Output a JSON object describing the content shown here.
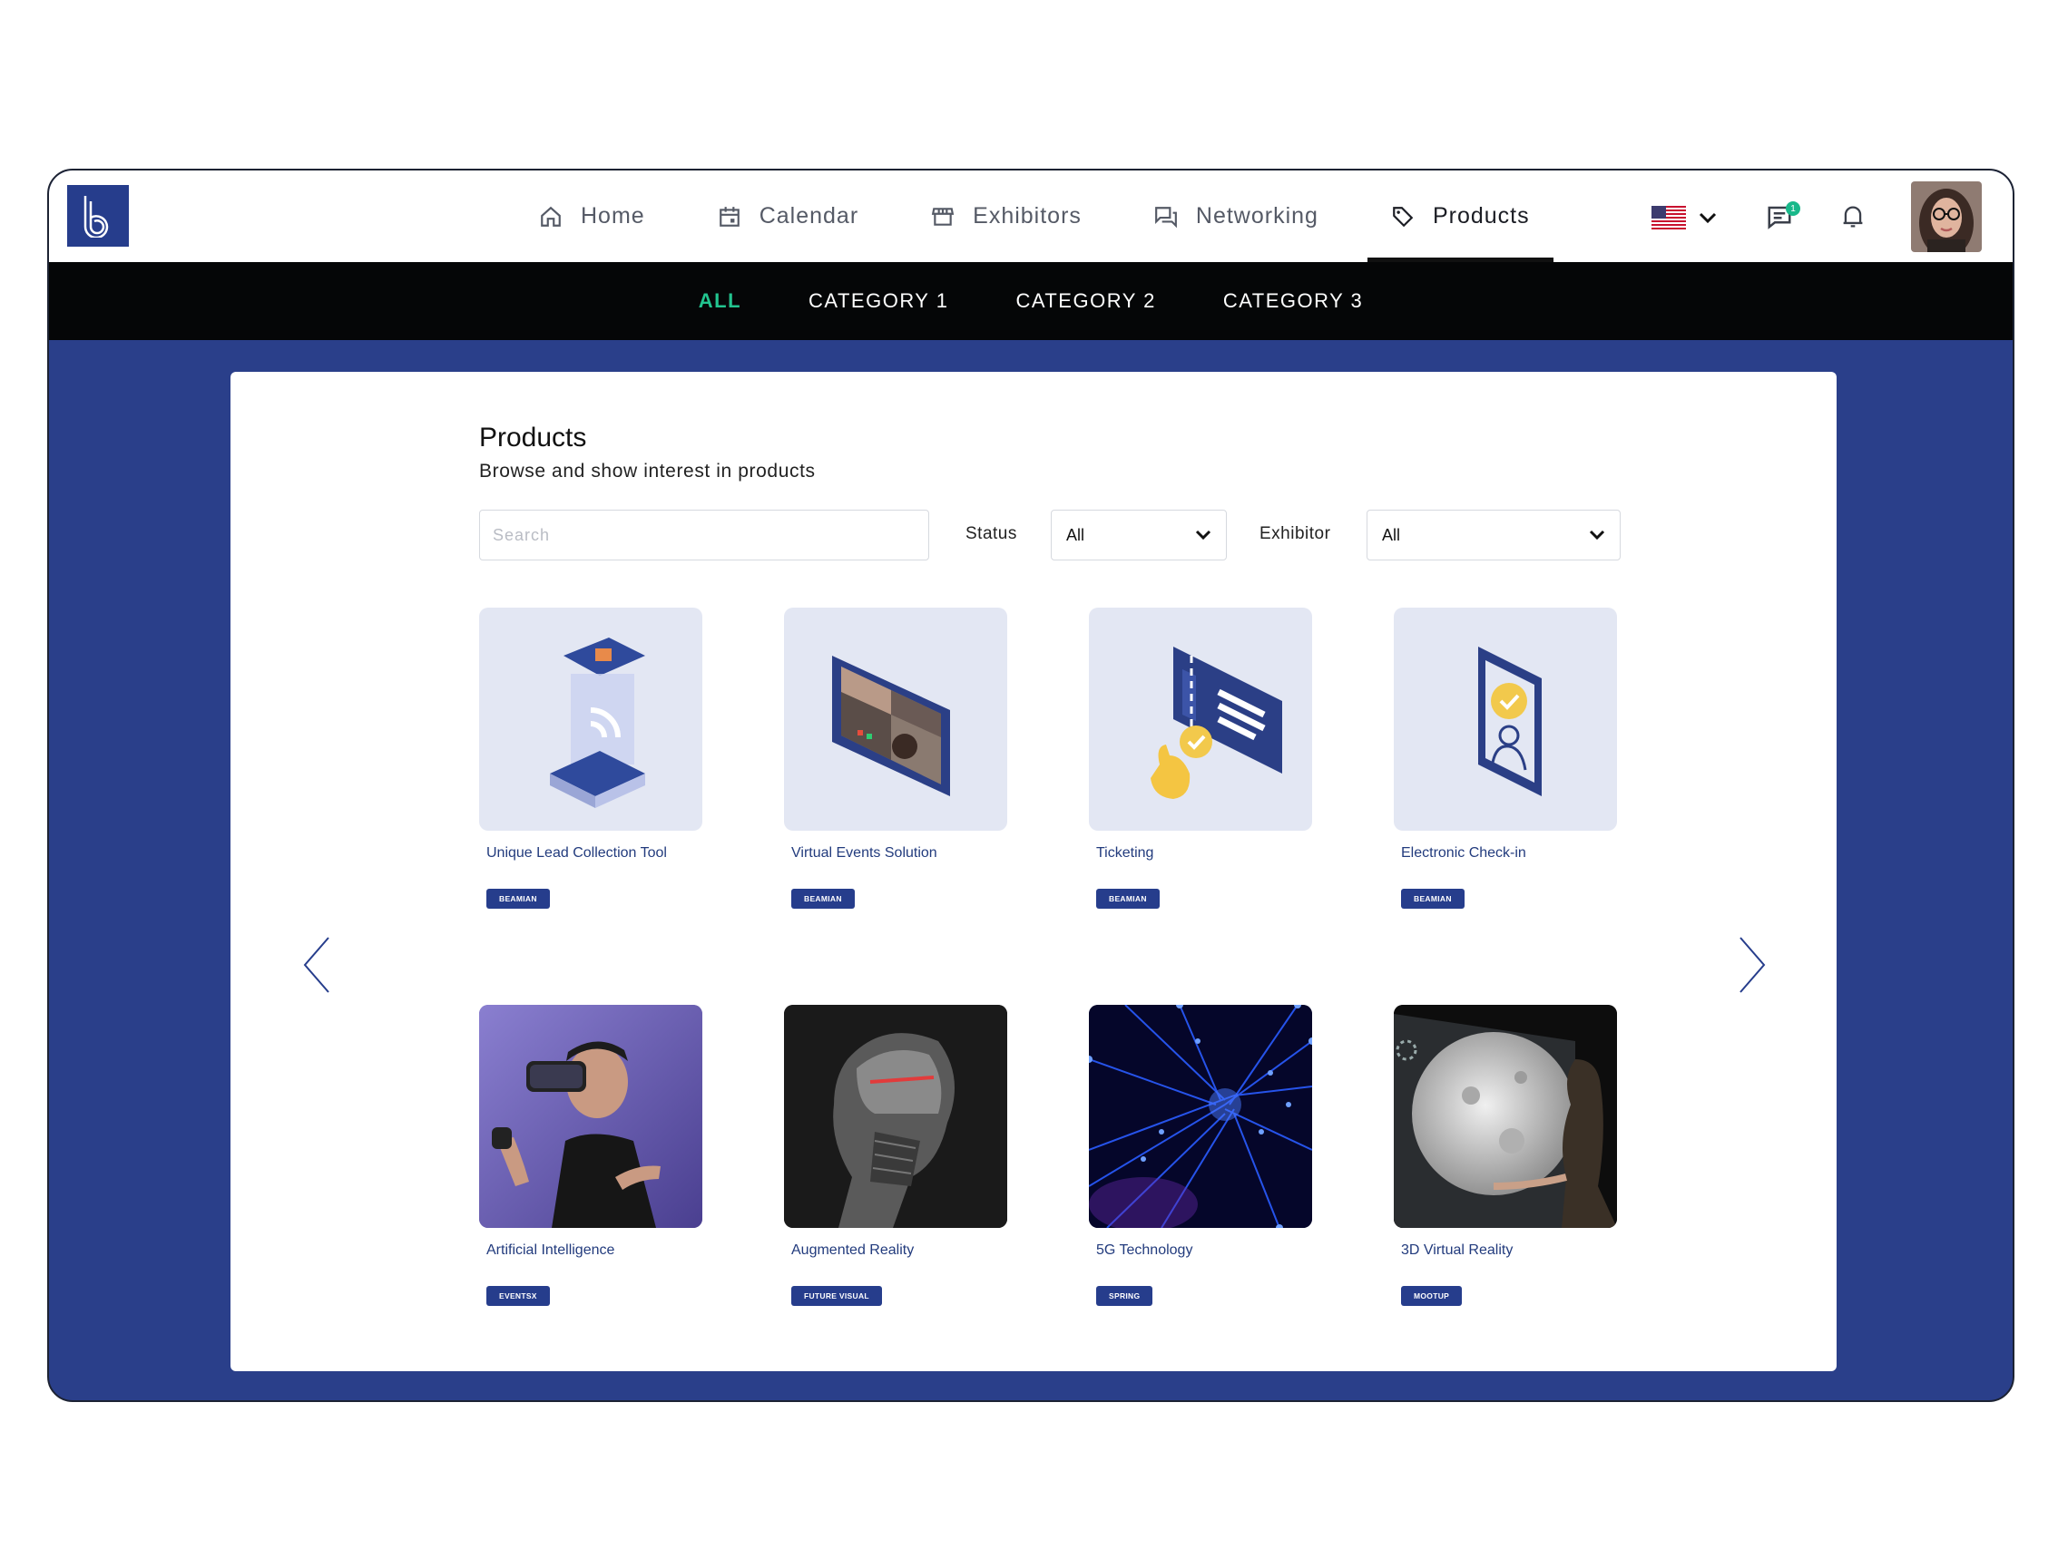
{
  "nav": {
    "items": [
      {
        "label": "Home",
        "icon": "home-icon"
      },
      {
        "label": "Calendar",
        "icon": "calendar-icon"
      },
      {
        "label": "Exhibitors",
        "icon": "store-icon"
      },
      {
        "label": "Networking",
        "icon": "chat-icon"
      },
      {
        "label": "Products",
        "icon": "tag-icon",
        "active": true
      }
    ],
    "notification_count": "1"
  },
  "categories": [
    "ALL",
    "CATEGORY 1",
    "CATEGORY 2",
    "CATEGORY 3"
  ],
  "page": {
    "title": "Products",
    "subtitle": "Browse and show interest in products"
  },
  "filters": {
    "search_placeholder": "Search",
    "status_label": "Status",
    "status_value": "All",
    "exhibitor_label": "Exhibitor",
    "exhibitor_value": "All"
  },
  "products": [
    {
      "name": "Unique Lead Collection Tool",
      "tag": "BEAMIAN"
    },
    {
      "name": "Virtual Events Solution",
      "tag": "BEAMIAN"
    },
    {
      "name": "Ticketing",
      "tag": "BEAMIAN"
    },
    {
      "name": "Electronic Check-in",
      "tag": "BEAMIAN"
    },
    {
      "name": "Artificial Intelligence",
      "tag": "EVENTSX"
    },
    {
      "name": "Augmented Reality",
      "tag": "FUTURE VISUAL"
    },
    {
      "name": "5G Technology",
      "tag": "SPRING"
    },
    {
      "name": "3D Virtual Reality",
      "tag": "MOOTUP"
    }
  ],
  "colors": {
    "brand_blue": "#263d8c",
    "background_blue": "#2a3f8a",
    "active_category": "#22c48f",
    "category_bar": "#050607"
  }
}
